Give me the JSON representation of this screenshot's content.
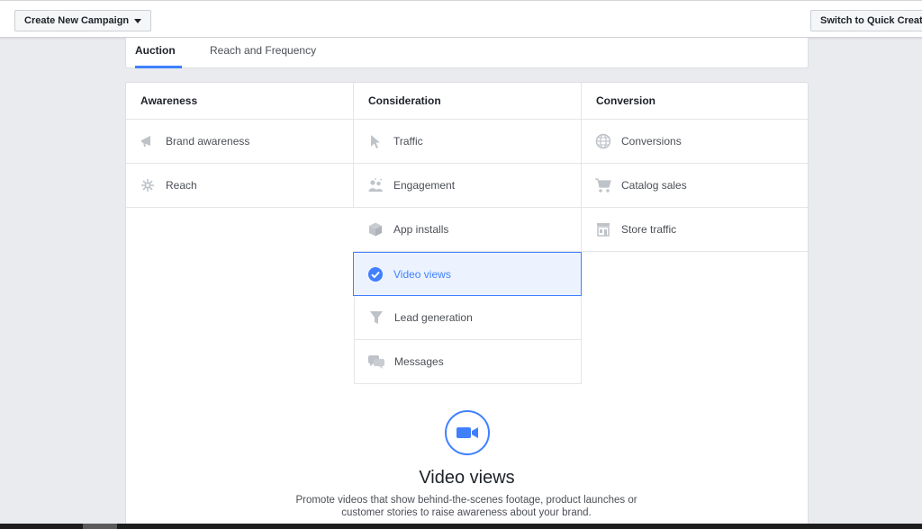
{
  "topbar": {
    "create_label": "Create New Campaign",
    "quick_label": "Switch to Quick Creation"
  },
  "tabs": [
    {
      "label": "Auction",
      "active": true
    },
    {
      "label": "Reach and Frequency",
      "active": false
    }
  ],
  "columns": [
    {
      "title": "Awareness",
      "items": [
        {
          "label": "Brand awareness",
          "icon": "megaphone-icon"
        },
        {
          "label": "Reach",
          "icon": "reach-icon"
        }
      ]
    },
    {
      "title": "Consideration",
      "items": [
        {
          "label": "Traffic",
          "icon": "cursor-icon"
        },
        {
          "label": "Engagement",
          "icon": "people-icon"
        },
        {
          "label": "App installs",
          "icon": "box-icon"
        },
        {
          "label": "Video views",
          "icon": "check-circle-icon",
          "selected": true
        },
        {
          "label": "Lead generation",
          "icon": "funnel-icon"
        },
        {
          "label": "Messages",
          "icon": "chat-bubbles-icon"
        }
      ]
    },
    {
      "title": "Conversion",
      "items": [
        {
          "label": "Conversions",
          "icon": "globe-icon"
        },
        {
          "label": "Catalog sales",
          "icon": "cart-icon"
        },
        {
          "label": "Store traffic",
          "icon": "store-icon"
        }
      ]
    }
  ],
  "detail": {
    "icon": "video-camera-icon",
    "title": "Video views",
    "description": "Promote videos that show behind-the-scenes footage, product launches or customer stories to raise awareness about your brand."
  },
  "colors": {
    "accent": "#4080ff",
    "selected_bg": "#ecf3ff",
    "icon_gray": "#bec3c9"
  }
}
